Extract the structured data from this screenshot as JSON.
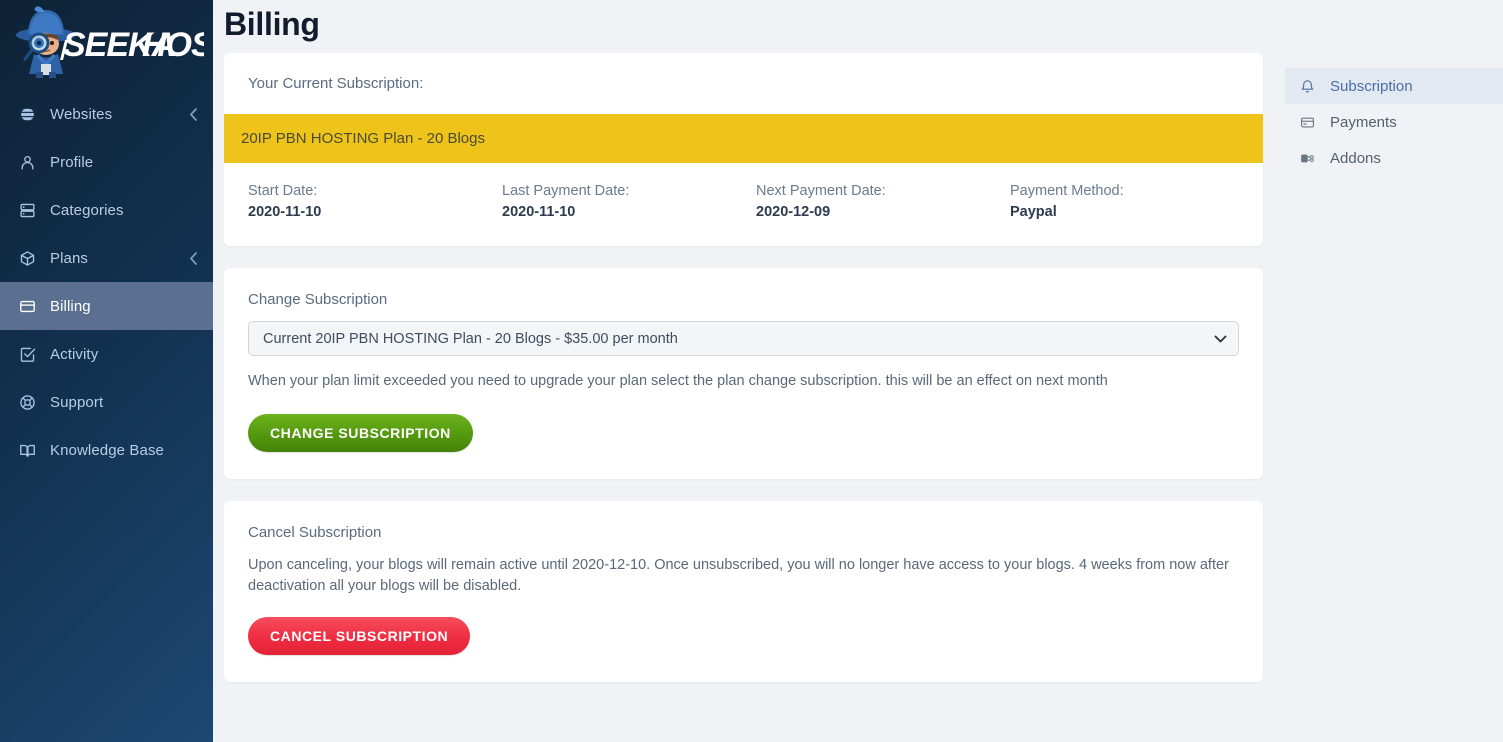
{
  "brand": {
    "name": "SEEKAHOST",
    "logo_icon": "detective-mascot-logo"
  },
  "sidebar": {
    "items": [
      {
        "label": "Websites",
        "icon": "globe-icon",
        "active": false,
        "expandable": true
      },
      {
        "label": "Profile",
        "icon": "user-icon",
        "active": false,
        "expandable": false
      },
      {
        "label": "Categories",
        "icon": "server-icon",
        "active": false,
        "expandable": false
      },
      {
        "label": "Plans",
        "icon": "package-icon",
        "active": false,
        "expandable": true
      },
      {
        "label": "Billing",
        "icon": "credit-card-icon",
        "active": true,
        "expandable": false
      },
      {
        "label": "Activity",
        "icon": "check-square-icon",
        "active": false,
        "expandable": false
      },
      {
        "label": "Support",
        "icon": "life-buoy-icon",
        "active": false,
        "expandable": false
      },
      {
        "label": "Knowledge Base",
        "icon": "book-icon",
        "active": false,
        "expandable": false
      }
    ]
  },
  "page": {
    "title": "Billing"
  },
  "subscription_card": {
    "heading": "Your Current Subscription:",
    "plan_banner": "20IP PBN HOSTING Plan - 20 Blogs",
    "details": [
      {
        "label": "Start Date:",
        "value": "2020-11-10"
      },
      {
        "label": "Last Payment Date:",
        "value": "2020-11-10"
      },
      {
        "label": "Next Payment Date:",
        "value": "2020-12-09"
      },
      {
        "label": "Payment Method:",
        "value": "Paypal"
      }
    ]
  },
  "change_card": {
    "label": "Change Subscription",
    "selected_option": "Current 20IP PBN HOSTING Plan - 20 Blogs - $35.00 per month",
    "help_text": "When your plan limit exceeded you need to upgrade your plan select the plan change subscription. this will be an effect on next month",
    "button_label": "CHANGE SUBSCRIPTION"
  },
  "cancel_card": {
    "label": "Cancel Subscription",
    "description": "Upon canceling, your blogs will remain active until 2020-12-10. Once unsubscribed, you will no longer have access to your blogs. 4 weeks from now after deactivation all your blogs will be disabled.",
    "button_label": "CANCEL SUBSCRIPTION"
  },
  "right_nav": {
    "items": [
      {
        "label": "Subscription",
        "icon": "bell-icon",
        "active": true
      },
      {
        "label": "Payments",
        "icon": "credit-card-icon",
        "active": false
      },
      {
        "label": "Addons",
        "icon": "puzzle-plug-icon",
        "active": false
      }
    ]
  },
  "colors": {
    "sidebar_dark": "#0e2236",
    "sidebar_light": "#1c4874",
    "sidebar_active": "#5b7090",
    "plan_banner_yellow": "#efc41a",
    "primary_green": "#54980d",
    "danger_red": "#ee2d42",
    "page_bg": "#f0f2f5",
    "right_nav_active_text": "#4a6da7",
    "right_nav_active_bg": "#e3e9f1",
    "title_color": "#131b2e"
  }
}
